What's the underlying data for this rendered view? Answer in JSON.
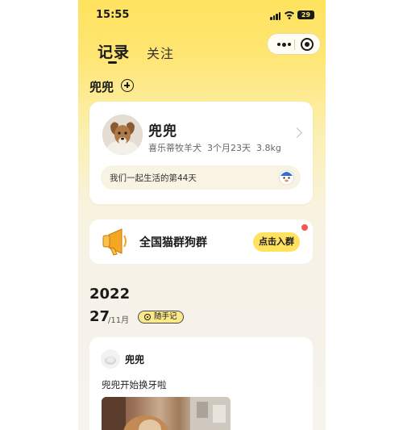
{
  "status_bar": {
    "time": "15:55",
    "battery": "29"
  },
  "header": {
    "tabs": [
      {
        "label": "记录",
        "active": true
      },
      {
        "label": "关注",
        "active": false
      }
    ]
  },
  "pet_tab": {
    "name": "兜兜"
  },
  "profile": {
    "name": "兜兜",
    "breed": "喜乐蒂牧羊犬",
    "age": "3个月23天",
    "weight": "3.8kg",
    "together_text": "我们一起生活的第44天"
  },
  "group_card": {
    "title": "全国猫群狗群",
    "button_label": "点击入群"
  },
  "timeline": {
    "year": "2022",
    "day": "27",
    "month": "/11月",
    "badge": "随手记"
  },
  "post": {
    "author": "兜兜",
    "text": "兜兜开始换牙啦"
  },
  "colors": {
    "accent": "#ffe25e",
    "notification": "#f05a5a"
  }
}
